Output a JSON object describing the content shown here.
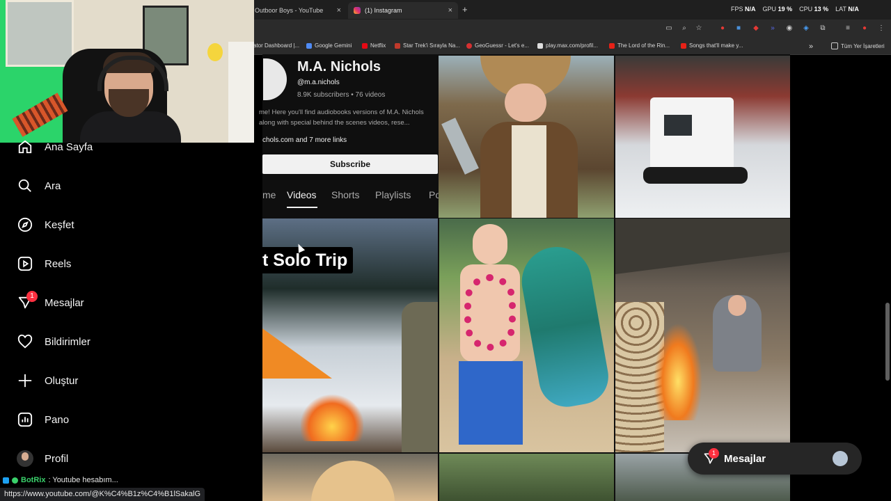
{
  "browser": {
    "tabs": [
      {
        "label": "Outboor Boys - YouTube",
        "close": "×"
      },
      {
        "label": "(1) Instagram",
        "close": "×"
      }
    ],
    "new_tab": "+",
    "stats": [
      {
        "label": "FPS",
        "value": "N/A"
      },
      {
        "label": "GPU",
        "value": "19 %"
      },
      {
        "label": "CPU",
        "value": "13 %"
      },
      {
        "label": "LAT",
        "value": "N/A"
      }
    ],
    "bookmarks": [
      {
        "label": "ator Dashboard |...",
        "color": "#555555"
      },
      {
        "label": "Google Gemini",
        "color": "#4f8bf5"
      },
      {
        "label": "Netflix",
        "color": "#e50914"
      },
      {
        "label": "Star Trek'i Sırayla Na...",
        "color": "#c0392b"
      },
      {
        "label": "GeoGuessr - Let's e...",
        "color": "#d63031"
      },
      {
        "label": "play.max.com/profil...",
        "color": "#222222"
      },
      {
        "label": "The Lord of the Rin...",
        "color": "#c0392b"
      },
      {
        "label": "Songs that'll make y...",
        "color": "#e62117"
      }
    ],
    "bookmarks_more": "»",
    "all_bookmarks": "Tüm Yer İşaretleri",
    "status_url": "https://www.youtube.com/@K%C4%B1z%C4%B1lSakalG"
  },
  "sidebar": {
    "items": [
      {
        "label": "Ana Sayfa",
        "icon": "home-icon"
      },
      {
        "label": "Ara",
        "icon": "search-icon"
      },
      {
        "label": "Keşfet",
        "icon": "compass-icon"
      },
      {
        "label": "Reels",
        "icon": "reels-icon"
      },
      {
        "label": "Mesajlar",
        "icon": "messenger-icon"
      },
      {
        "label": "Bildirimler",
        "icon": "heart-icon"
      },
      {
        "label": "Oluştur",
        "icon": "plus-icon"
      },
      {
        "label": "Pano",
        "icon": "dashboard-icon"
      },
      {
        "label": "Profil",
        "icon": "avatar"
      }
    ],
    "messages_badge": "1"
  },
  "chat": {
    "user": "BotRix",
    "text": ": Youtube hesabım..."
  },
  "channel": {
    "name": "M.A. Nichols",
    "handle": "@m.a.nichols",
    "meta": "8.9K subscribers • 76 videos",
    "desc_line1": "me! Here you'll find audiobooks versions of M.A. Nichols",
    "desc_line2": "along with special behind the scenes videos, rese...",
    "links": "chols.com and 7 more links",
    "subscribe": "Subscribe",
    "tabs": [
      "me",
      "Videos",
      "Shorts",
      "Playlists",
      "Po"
    ]
  },
  "thumbnails": {
    "title_overlay": "t Solo Trip"
  },
  "messages_pill": {
    "label": "Mesajlar",
    "badge": "1"
  }
}
